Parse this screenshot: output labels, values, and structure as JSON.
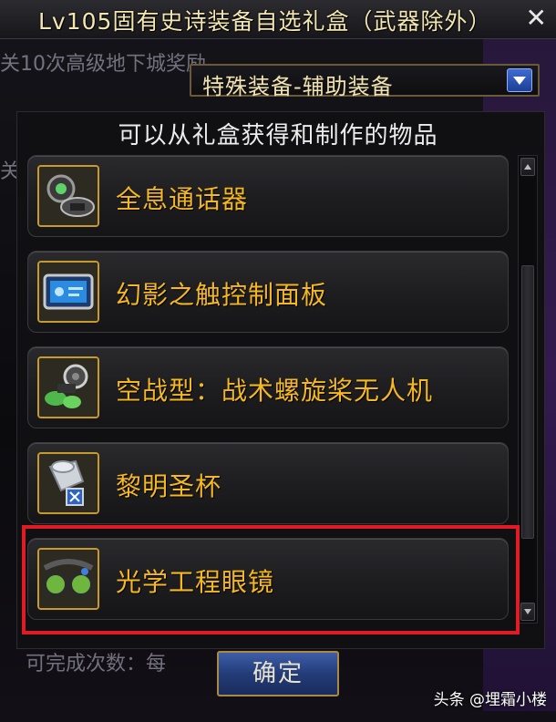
{
  "window": {
    "title": "Lv105固有史诗装备自选礼盒（武器除外）",
    "close_label": "✕"
  },
  "background": {
    "text_1": "关10次高级地下城奖励",
    "text_2": "关",
    "text_3": "可完成次数：每"
  },
  "filter": {
    "selected": "特殊装备-辅助装备"
  },
  "list": {
    "heading": "可以从礼盒获得和制作的物品",
    "items": [
      {
        "label": "全息通话器",
        "icon": "headset-device-icon"
      },
      {
        "label": "幻影之触控制面板",
        "icon": "control-panel-icon"
      },
      {
        "label": "空战型：战术螺旋桨无人机",
        "icon": "drone-icon"
      },
      {
        "label": "黎明圣杯",
        "icon": "grail-icon"
      },
      {
        "label": "光学工程眼镜",
        "icon": "goggles-icon"
      }
    ]
  },
  "buttons": {
    "confirm": "确定"
  },
  "watermark": "头条 @埋霜小楼",
  "colors": {
    "item_label": "#f5b823",
    "highlight": "#e01b24",
    "accent_blue": "#2a4c9c"
  }
}
